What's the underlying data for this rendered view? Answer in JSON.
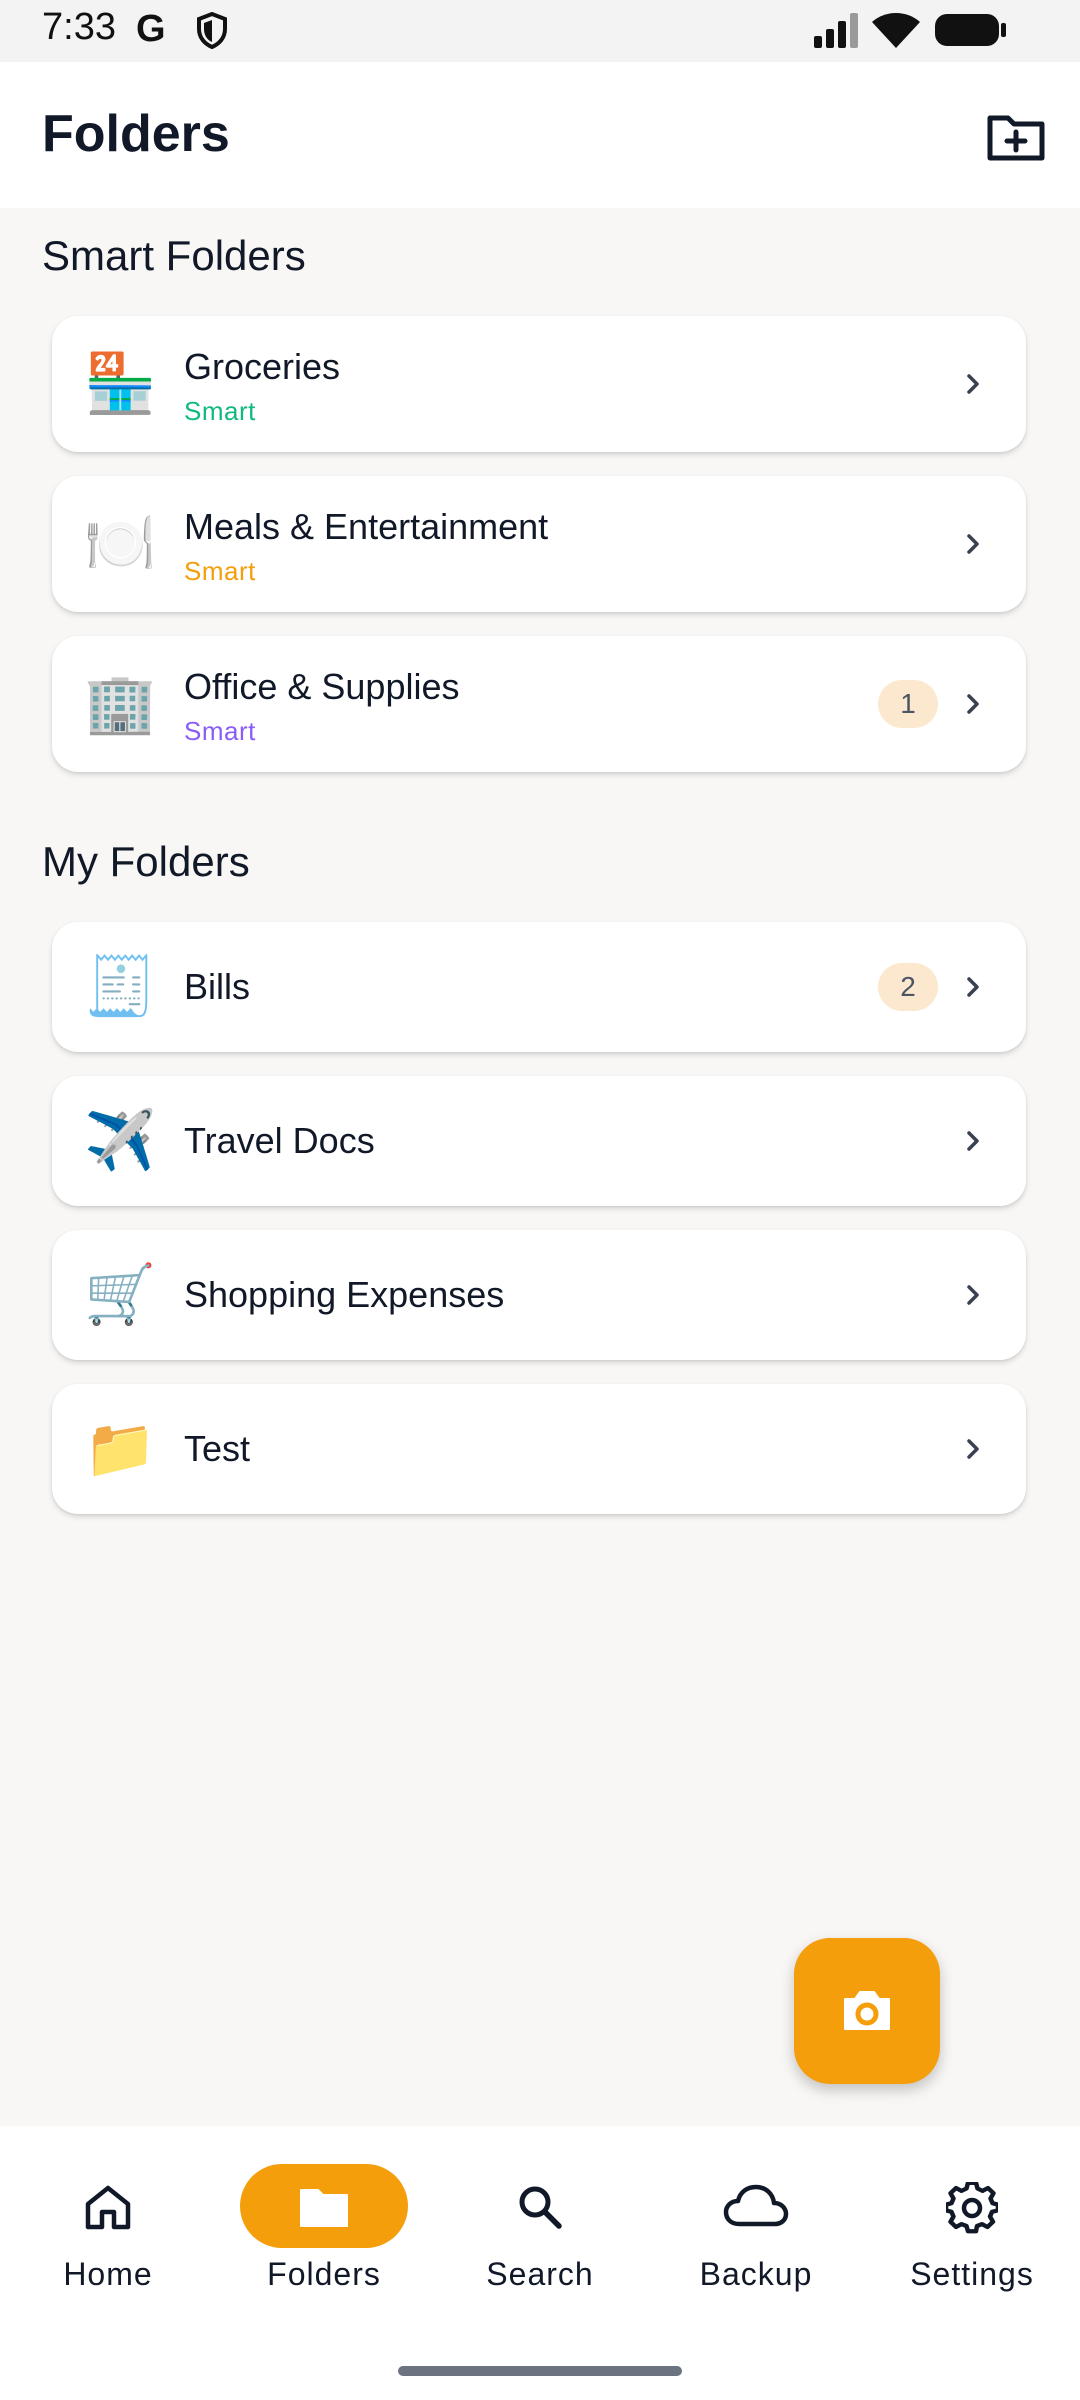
{
  "status_bar": {
    "time": "7:33",
    "g_glyph": "G"
  },
  "header": {
    "title": "Folders",
    "new_folder_icon": "folder-plus-icon"
  },
  "smart_section": {
    "title": "Smart Folders",
    "items": [
      {
        "emoji": "🏪",
        "name": "Groceries",
        "sub": "Smart",
        "sub_color": "#10b981",
        "badge": ""
      },
      {
        "emoji": "🍽️",
        "name": "Meals & Entertainment",
        "sub": "Smart",
        "sub_color": "#f59e0b",
        "badge": ""
      },
      {
        "emoji": "🏢",
        "name": "Office & Supplies",
        "sub": "Smart",
        "sub_color": "#8b5cf6",
        "badge": "1"
      }
    ]
  },
  "my_section": {
    "title": "My Folders",
    "items": [
      {
        "emoji": "🧾",
        "name": "Bills",
        "badge": "2"
      },
      {
        "emoji": "✈️",
        "name": "Travel Docs",
        "badge": ""
      },
      {
        "emoji": "🛒",
        "name": "Shopping Expenses",
        "badge": ""
      },
      {
        "emoji": "📁",
        "name": "Test",
        "badge": ""
      }
    ]
  },
  "fab": {
    "icon": "camera-icon"
  },
  "bottom_nav": {
    "items": [
      {
        "label": "Home",
        "icon": "home-icon",
        "active": false
      },
      {
        "label": "Folders",
        "icon": "folder-icon",
        "active": true
      },
      {
        "label": "Search",
        "icon": "search-icon",
        "active": false
      },
      {
        "label": "Backup",
        "icon": "cloud-icon",
        "active": false
      },
      {
        "label": "Settings",
        "icon": "gear-icon",
        "active": false
      }
    ]
  },
  "colors": {
    "accent": "#f59e0b",
    "badge_bg": "#fbe8cf",
    "page_bg": "#f8f7f5"
  }
}
